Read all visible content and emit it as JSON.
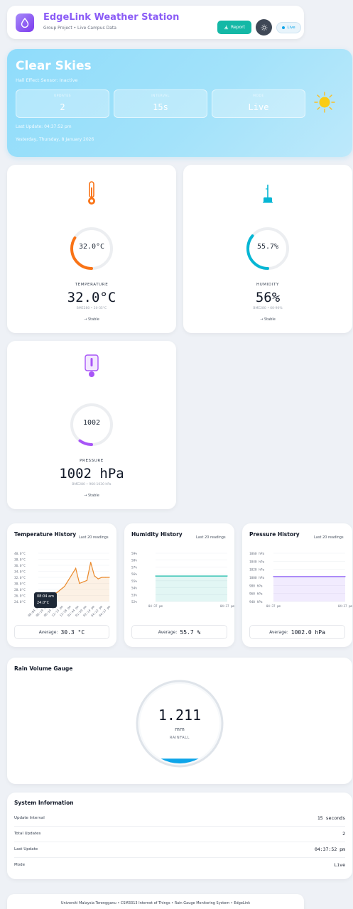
{
  "header": {
    "title": "EdgeLink Weather Station",
    "subtitle": "Group Project • Live Campus Data",
    "report_label": "Report",
    "live_label": "Live",
    "logo_icon": "droplet-icon",
    "theme_icon": "sun-icon"
  },
  "hero": {
    "title": "Clear Skies",
    "sensor_status": "Hall Effect Sensor: Inactive",
    "stats": [
      {
        "label": "UPDATES",
        "value": "2"
      },
      {
        "label": "INTERVAL",
        "value": "15s"
      },
      {
        "label": "MODE",
        "value": "Live"
      }
    ],
    "last_update": "Last Update: 04:37:52 pm",
    "date": "Yesterday, Thursday, 8 January 2026",
    "weather_icon": "sun-icon"
  },
  "metrics": {
    "temperature": {
      "icon": "thermometer-icon",
      "gauge_text": "32.0°C",
      "label": "TEMPERATURE",
      "value": "32.0°C",
      "range": "BME280 • 20-35°C",
      "trend": "→ Stable",
      "fraction": 0.34,
      "color": "#f97316"
    },
    "humidity": {
      "icon": "hygrometer-icon",
      "gauge_text": "55.7%",
      "label": "HUMIDITY",
      "value": "56%",
      "range": "BME280 • 60-90%",
      "trend": "→ Stable",
      "fraction": 0.36,
      "color": "#06b6d4"
    },
    "pressure": {
      "icon": "barometer-icon",
      "gauge_text": "1002",
      "label": "PRESSURE",
      "value": "1002 hPa",
      "range": "BME280 • 960-1030 hPa",
      "trend": "→ Stable",
      "fraction": 0.1,
      "color": "#a855f7"
    }
  },
  "history": {
    "temperature": {
      "title": "Temperature History",
      "subtitle": "Last 20 readings",
      "avg_label": "Average:",
      "avg_value": "30.3 °C",
      "tooltip_time": "08:04 am",
      "tooltip_value": "24.0°C"
    },
    "humidity": {
      "title": "Humidity History",
      "subtitle": "Last 20 readings",
      "avg_label": "Average:",
      "avg_value": "55.7 %"
    },
    "pressure": {
      "title": "Pressure History",
      "subtitle": "Last 20 readings",
      "avg_label": "Average:",
      "avg_value": "1002.0 hPa"
    }
  },
  "rain": {
    "title": "Rain Volume Gauge",
    "value": "1.211",
    "unit": "mm",
    "label": "RAINFALL",
    "fraction": 0.06
  },
  "system": {
    "title": "System Information",
    "rows": [
      {
        "key": "Update Interval",
        "value": "15 seconds"
      },
      {
        "key": "Total Updates",
        "value": "2"
      },
      {
        "key": "Last Update",
        "value": "04:37:52 pm"
      },
      {
        "key": "Mode",
        "value": "Live"
      }
    ]
  },
  "footer": {
    "text": "Universiti Malaysia Terengganu • CSM3313 Internet of Things • Rain Gauge Monitoring System • EdgeLink"
  },
  "chart_data": [
    {
      "type": "area",
      "ylim": [
        24,
        40
      ],
      "ytick_labels": [
        "40.0°C",
        "38.0°C",
        "36.0°C",
        "34.0°C",
        "32.0°C",
        "30.0°C",
        "28.0°C",
        "26.0°C",
        "24.0°C"
      ],
      "xtick_labels": [
        "08:04 am",
        "08:19 am",
        "08:34 am",
        "12:13 pm",
        "12:28 pm",
        "01:44 pm",
        "01:59 pm",
        "02:14 pm",
        "04:22 pm",
        "04:37 pm"
      ],
      "values": [
        24.0,
        24.5,
        25.0,
        26.0,
        26.5,
        27.0,
        28.0,
        29.0,
        31.0,
        33.0,
        35.0,
        30.0,
        30.5,
        31.0,
        37.0,
        32.5,
        31.5,
        32.0,
        32.0,
        32.0
      ],
      "color": "#ea8a2c"
    },
    {
      "type": "area",
      "ylim": [
        52,
        59
      ],
      "ytick_labels": [
        "59%",
        "58%",
        "57%",
        "56%",
        "55%",
        "54%",
        "53%",
        "52%"
      ],
      "xtick_labels": [
        "04:37 pm",
        "04:37 pm"
      ],
      "values": [
        55.7,
        55.7
      ],
      "color": "#14b8a6"
    },
    {
      "type": "area",
      "ylim": [
        940,
        1060
      ],
      "ytick_labels": [
        "1060 hPa",
        "1040 hPa",
        "1020 hPa",
        "1000 hPa",
        "980 hPa",
        "960 hPa",
        "940 hPa"
      ],
      "xtick_labels": [
        "04:37 pm",
        "04:37 pm"
      ],
      "values": [
        1002,
        1002
      ],
      "color": "#8b5cf6"
    }
  ]
}
